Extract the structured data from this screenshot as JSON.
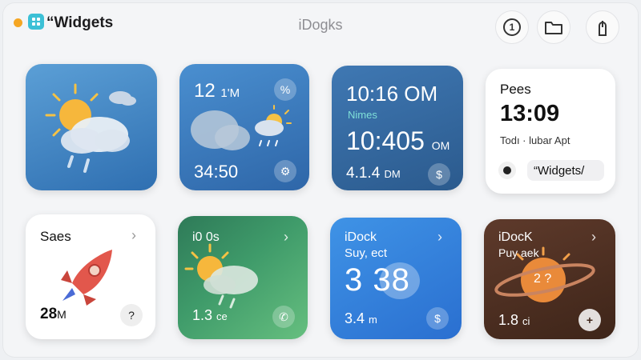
{
  "titlebar": {
    "app_title": "“Widgets",
    "center_title": "iDogks",
    "buttons": [
      {
        "icon": "info-circle-icon",
        "label": "1"
      },
      {
        "icon": "folder-icon"
      },
      {
        "icon": "share-icon"
      }
    ]
  },
  "widgets": {
    "w1": {
      "icon": "sun-cloud-rain-icon"
    },
    "w2": {
      "time": "12",
      "unit": "1'M",
      "temp": "34:50",
      "icon": "cloud-sun-rain-icon"
    },
    "w3": {
      "time": "10:16 OM",
      "label": "Nimes",
      "big": "10:405",
      "big_unit": "OM",
      "bottom": "4.1.4",
      "bottom_unit": "DM"
    },
    "w4": {
      "title": "Pees",
      "time": "13:0",
      "time_tail": "9",
      "subtitle": "Todı · lubar Apt",
      "pill": "“Widgets/"
    },
    "w5": {
      "title": "Saes",
      "value": "28",
      "unit": "M",
      "icon": "rocket-icon"
    },
    "w6": {
      "title": "i0 0s",
      "value": "1.3",
      "unit": "ce",
      "icon": "sun-cloud-rain-icon"
    },
    "w7": {
      "title": "iDock",
      "subtitle": "Suy, ect",
      "big": "3 3",
      "big_tail": "8",
      "value": "3.4",
      "unit": "m"
    },
    "w8": {
      "title": "iDocK",
      "subtitle": "Puy aek",
      "planet_label": "2 ?",
      "value": "1.8",
      "unit": "ci"
    }
  },
  "colors": {
    "accent_orange": "#f5a623",
    "app_icon": "#3cc0d6"
  }
}
